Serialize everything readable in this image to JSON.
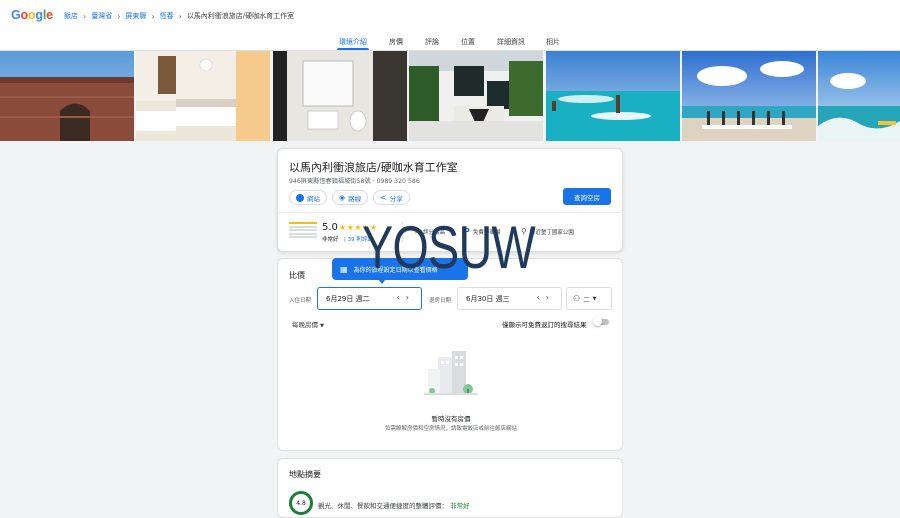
{
  "header": {
    "logo": [
      "G",
      "o",
      "o",
      "g",
      "l",
      "e"
    ],
    "breadcrumbs": [
      "飯店",
      "臺灣省",
      "屏東縣",
      "恆春",
      "以馬內利衝浪旅店/硬咖水育工作室"
    ]
  },
  "tabs": [
    "環境介紹",
    "房價",
    "評論",
    "位置",
    "詳細資訊",
    "相片"
  ],
  "hotel": {
    "name": "以馬內利衝浪旅店/硬咖水育工作室",
    "address": "946屏東縣恆春鎮福城街58號 · 0989 320 586",
    "website_label": "網站",
    "directions_label": "路線",
    "share_label": "分享",
    "check_availability_label": "查詢空房",
    "score": "5.0",
    "stars": "★★★★★",
    "rating_word": "非常好",
    "reviews": "| 39 則評論",
    "amenities": [
      "評分最高",
      "免費停車場",
      "鄰近墾丁國家公園"
    ]
  },
  "prices": {
    "title": "比價",
    "tooltip": "為你的旅程設定日期以查看價格",
    "checkin_label": "入住日期",
    "checkin_value": "6月29日 週二",
    "checkout_label": "退房日期",
    "checkout_value": "6月30日 週三",
    "guests_value": "二",
    "per_night_label": "每晚房價",
    "toggle_label": "僅顯示可免費退訂的搜尋結果",
    "empty_title": "暫時沒有房價",
    "empty_subtitle": "如需瞭解房價和空房情況，請致電飯店或前往飯店網站"
  },
  "location": {
    "title": "地點摘要",
    "score": "4.8",
    "text": "觀光、休閒、餐飲和交通便捷度的整體評價：",
    "verdict": "非常好"
  },
  "watermark": "YOSUW"
}
